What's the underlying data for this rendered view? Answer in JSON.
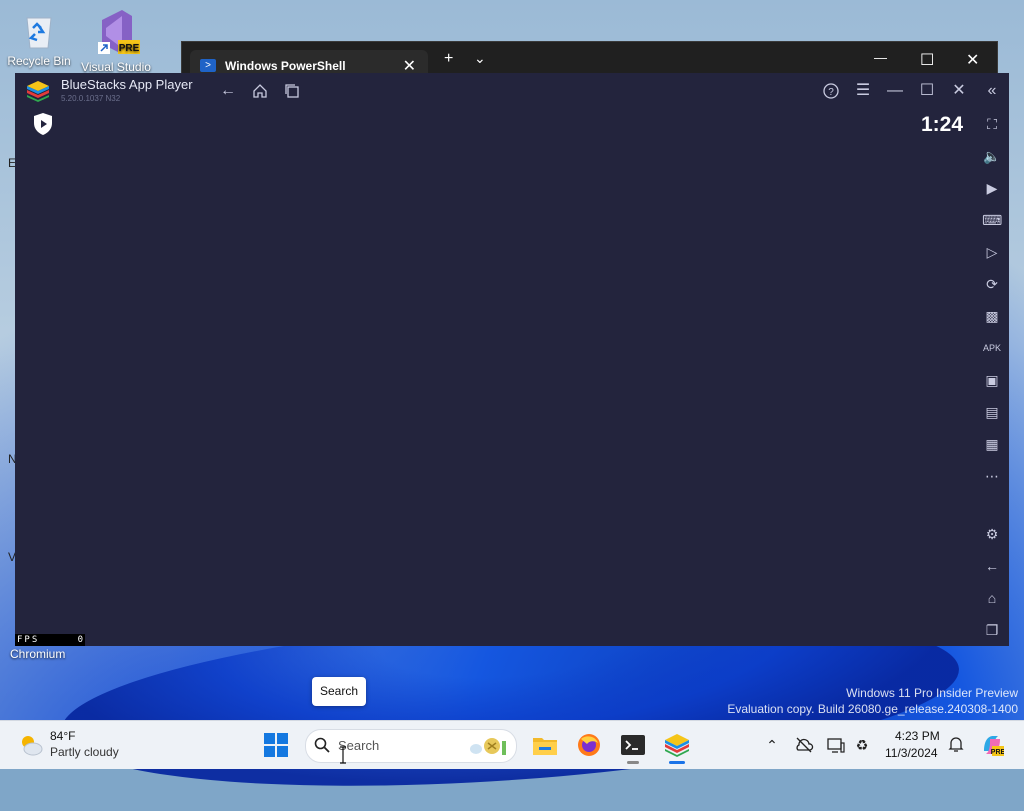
{
  "desktop": {
    "icons": [
      {
        "label": "Recycle Bin"
      },
      {
        "label": "Visual Studio",
        "badge": "PRE"
      }
    ],
    "edge_letters": [
      "E",
      "N",
      "V"
    ],
    "chromium_label": "Chromium",
    "watermark": {
      "line1": "Windows 11 Pro Insider Preview",
      "line2": "Evaluation copy. Build 26080.ge_release.240308-1400"
    },
    "tooltip": "Search"
  },
  "powershell": {
    "tab_title": "Windows PowerShell",
    "new_tab": "+",
    "dropdown": "⌄",
    "minimize": "—",
    "maximize": "☐",
    "close": "✕"
  },
  "bluestacks": {
    "title": "BlueStacks App Player",
    "version": "5.20.0.1037 N32",
    "clock": "1:24",
    "fps_label": "FPS",
    "fps_value": "0",
    "colors": {
      "background": "#23243d",
      "titlebar": "#23243d",
      "icon": "#c9cbe0"
    },
    "sidebar_tools": [
      "fullscreen",
      "volume",
      "media",
      "keyboard",
      "macro-record",
      "rotate",
      "game-controls",
      "apk-install",
      "screenshot",
      "screen-record",
      "gallery",
      "more",
      "settings",
      "back",
      "home",
      "recent-apps"
    ]
  },
  "taskbar": {
    "weather": {
      "temp": "84°F",
      "desc": "Partly cloudy"
    },
    "search_placeholder": "Search",
    "clock": {
      "time": "4:23 PM",
      "date": "11/3/2024"
    },
    "apps": [
      "file-explorer",
      "firefox",
      "terminal",
      "bluestacks"
    ],
    "tray": [
      "chevron-up",
      "onedrive-offline",
      "display",
      "accessibility",
      "notifications",
      "copilot"
    ]
  }
}
